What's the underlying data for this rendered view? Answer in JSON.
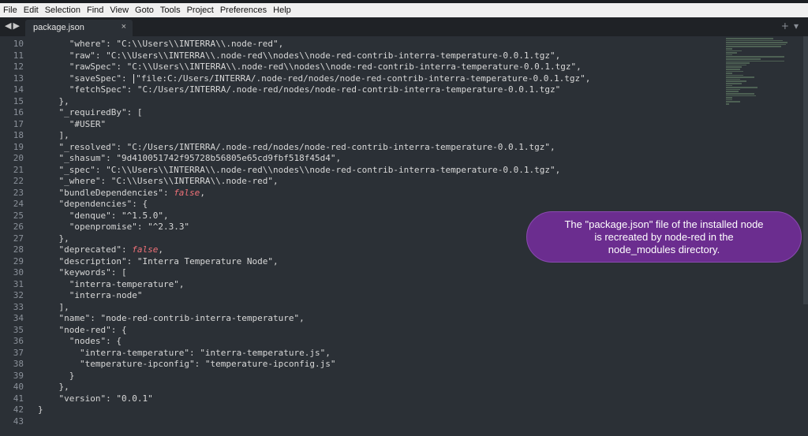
{
  "menu": [
    "File",
    "Edit",
    "Selection",
    "Find",
    "View",
    "Goto",
    "Tools",
    "Project",
    "Preferences",
    "Help"
  ],
  "tab": {
    "label": "package.json",
    "close": "×"
  },
  "nav": {
    "back": "◀",
    "forward": "▶"
  },
  "tab_actions": {
    "add": "+",
    "more": "▾"
  },
  "line_numbers": [
    "10",
    "11",
    "12",
    "13",
    "14",
    "15",
    "16",
    "17",
    "18",
    "19",
    "20",
    "21",
    "22",
    "23",
    "24",
    "25",
    "26",
    "27",
    "28",
    "29",
    "30",
    "31",
    "32",
    "33",
    "34",
    "35",
    "36",
    "37",
    "38",
    "39",
    "40",
    "41",
    "42",
    "43"
  ],
  "tooltip": {
    "line1": "The \"package.json\" file of the installed node",
    "line2": "is recreated by node-red in the",
    "line3": "node_modules directory."
  },
  "code": [
    [
      {
        "t": "      \"where\": ",
        "c": "k"
      },
      {
        "t": "\"C:\\\\Users\\\\INTERRA\\\\.node-red\"",
        "c": "s"
      },
      {
        "t": ",",
        "c": "k"
      }
    ],
    [
      {
        "t": "      \"raw\": ",
        "c": "k"
      },
      {
        "t": "\"C:\\\\Users\\\\INTERRA\\\\.node-red\\\\nodes\\\\node-red-contrib-interra-temperature-0.0.1.tgz\"",
        "c": "s"
      },
      {
        "t": ",",
        "c": "k"
      }
    ],
    [
      {
        "t": "      \"rawSpec\": ",
        "c": "k"
      },
      {
        "t": "\"C:\\\\Users\\\\INTERRA\\\\.node-red\\\\nodes\\\\node-red-contrib-interra-temperature-0.0.1.tgz\"",
        "c": "s"
      },
      {
        "t": ",",
        "c": "k"
      }
    ],
    [
      {
        "t": "      \"saveSpec\": ",
        "c": "k"
      },
      {
        "t": "CURSOR",
        "c": "cur"
      },
      {
        "t": "\"file:C:/Users/INTERRA/.node-red/nodes/node-red-contrib-interra-temperature-0.0.1.tgz\"",
        "c": "s"
      },
      {
        "t": ",",
        "c": "k"
      }
    ],
    [
      {
        "t": "      \"fetchSpec\": ",
        "c": "k"
      },
      {
        "t": "\"C:/Users/INTERRA/.node-red/nodes/node-red-contrib-interra-temperature-0.0.1.tgz\"",
        "c": "s"
      }
    ],
    [
      {
        "t": "    },",
        "c": "k"
      }
    ],
    [
      {
        "t": "    \"_requiredBy\": [",
        "c": "k"
      }
    ],
    [
      {
        "t": "      ",
        "c": "k"
      },
      {
        "t": "\"#USER\"",
        "c": "s"
      }
    ],
    [
      {
        "t": "    ],",
        "c": "k"
      }
    ],
    [
      {
        "t": "    \"_resolved\": ",
        "c": "k"
      },
      {
        "t": "\"C:/Users/INTERRA/.node-red/nodes/node-red-contrib-interra-temperature-0.0.1.tgz\"",
        "c": "s"
      },
      {
        "t": ",",
        "c": "k"
      }
    ],
    [
      {
        "t": "    \"_shasum\": ",
        "c": "k"
      },
      {
        "t": "\"9d410051742f95728b56805e65cd9fbf518f45d4\"",
        "c": "s"
      },
      {
        "t": ",",
        "c": "k"
      }
    ],
    [
      {
        "t": "    \"_spec\": ",
        "c": "k"
      },
      {
        "t": "\"C:\\\\Users\\\\INTERRA\\\\.node-red\\\\nodes\\\\node-red-contrib-interra-temperature-0.0.1.tgz\"",
        "c": "s"
      },
      {
        "t": ",",
        "c": "k"
      }
    ],
    [
      {
        "t": "    \"_where\": ",
        "c": "k"
      },
      {
        "t": "\"C:\\\\Users\\\\INTERRA\\\\.node-red\"",
        "c": "s"
      },
      {
        "t": ",",
        "c": "k"
      }
    ],
    [
      {
        "t": "    \"bundleDependencies\": ",
        "c": "k"
      },
      {
        "t": "false",
        "c": "b"
      },
      {
        "t": ",",
        "c": "k"
      }
    ],
    [
      {
        "t": "    \"dependencies\": {",
        "c": "k"
      }
    ],
    [
      {
        "t": "      \"denque\": ",
        "c": "k"
      },
      {
        "t": "\"^1.5.0\"",
        "c": "s"
      },
      {
        "t": ",",
        "c": "k"
      }
    ],
    [
      {
        "t": "      \"openpromise\": ",
        "c": "k"
      },
      {
        "t": "\"^2.3.3\"",
        "c": "s"
      }
    ],
    [
      {
        "t": "    },",
        "c": "k"
      }
    ],
    [
      {
        "t": "    \"deprecated\": ",
        "c": "k"
      },
      {
        "t": "false",
        "c": "b"
      },
      {
        "t": ",",
        "c": "k"
      }
    ],
    [
      {
        "t": "    \"description\": ",
        "c": "k"
      },
      {
        "t": "\"Interra Temperature Node\"",
        "c": "s"
      },
      {
        "t": ",",
        "c": "k"
      }
    ],
    [
      {
        "t": "    \"keywords\": [",
        "c": "k"
      }
    ],
    [
      {
        "t": "      ",
        "c": "k"
      },
      {
        "t": "\"interra-temperature\"",
        "c": "s"
      },
      {
        "t": ",",
        "c": "k"
      }
    ],
    [
      {
        "t": "      ",
        "c": "k"
      },
      {
        "t": "\"interra-node\"",
        "c": "s"
      }
    ],
    [
      {
        "t": "    ],",
        "c": "k"
      }
    ],
    [
      {
        "t": "    \"name\": ",
        "c": "k"
      },
      {
        "t": "\"node-red-contrib-interra-temperature\"",
        "c": "s"
      },
      {
        "t": ",",
        "c": "k"
      }
    ],
    [
      {
        "t": "    \"node-red\": {",
        "c": "k"
      }
    ],
    [
      {
        "t": "      \"nodes\": {",
        "c": "k"
      }
    ],
    [
      {
        "t": "        \"interra-temperature\": ",
        "c": "k"
      },
      {
        "t": "\"interra-temperature.js\"",
        "c": "s"
      },
      {
        "t": ",",
        "c": "k"
      }
    ],
    [
      {
        "t": "        \"temperature-ipconfig\": ",
        "c": "k"
      },
      {
        "t": "\"temperature-ipconfig.js\"",
        "c": "s"
      }
    ],
    [
      {
        "t": "      }",
        "c": "k"
      }
    ],
    [
      {
        "t": "    },",
        "c": "k"
      }
    ],
    [
      {
        "t": "    \"version\": ",
        "c": "k"
      },
      {
        "t": "\"0.0.1\"",
        "c": "s"
      }
    ],
    [
      {
        "t": "}",
        "c": "k"
      }
    ],
    [
      {
        "t": "",
        "c": "k"
      }
    ]
  ]
}
